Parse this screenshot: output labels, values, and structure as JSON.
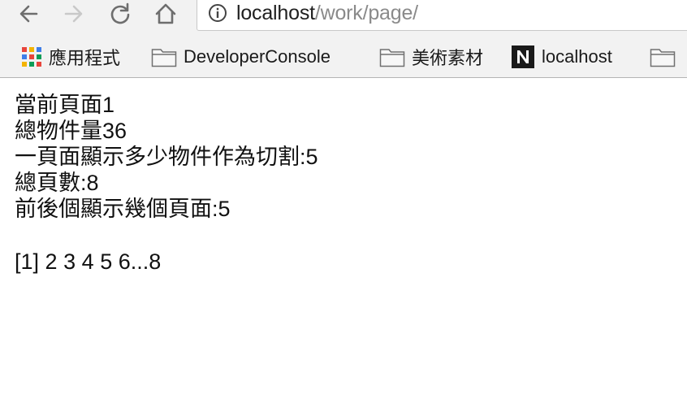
{
  "browser": {
    "url_host": "localhost",
    "url_path": "/work/page/"
  },
  "bookmarks": [
    {
      "label": "應用程式",
      "icon": "apps-grid-icon"
    },
    {
      "label": "DeveloperConsole",
      "icon": "folder-icon"
    },
    {
      "label": "美術素材",
      "icon": "folder-icon"
    },
    {
      "label": "localhost",
      "icon": "notion-n-icon"
    }
  ],
  "page": {
    "line_current": "當前頁面1",
    "line_total_items": "總物件量36",
    "line_per_page": "一頁面顯示多少物件作為切割:5",
    "line_total_pages": "總頁數:8",
    "line_around": "前後個顯示幾個頁面:5"
  },
  "pager": {
    "current": "[1]",
    "pages": [
      "2",
      "3",
      "4",
      "5"
    ],
    "tail": "6...8"
  }
}
